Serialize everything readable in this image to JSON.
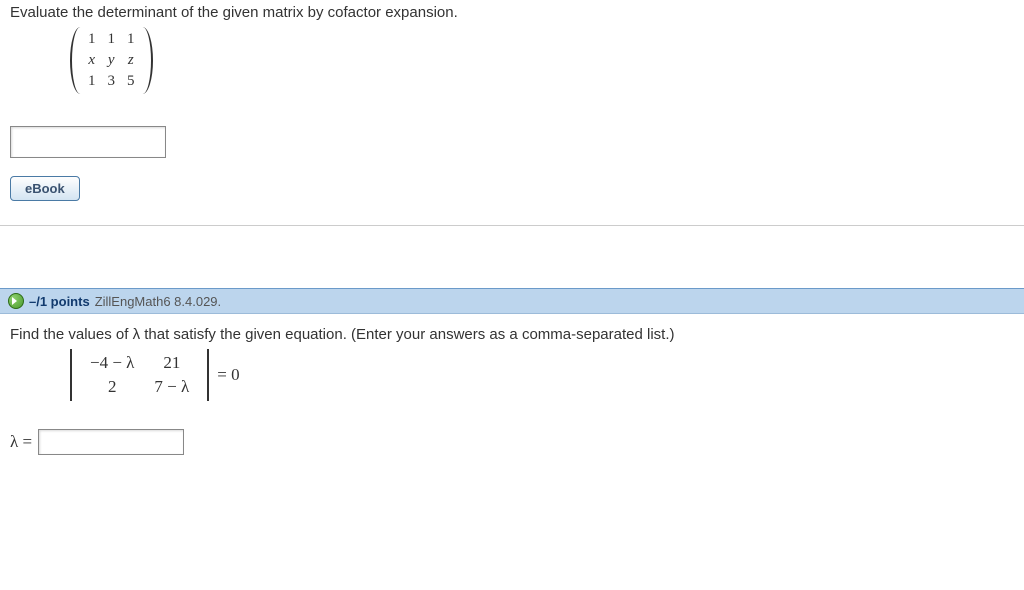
{
  "q1": {
    "prompt": "Evaluate the determinant of the given matrix by cofactor expansion.",
    "matrix": [
      [
        "1",
        "1",
        "1"
      ],
      [
        "x",
        "y",
        "z"
      ],
      [
        "1",
        "3",
        "5"
      ]
    ],
    "ebook_label": "eBook"
  },
  "q2": {
    "points": "–/1 points",
    "source": "ZillEngMath6 8.4.029.",
    "prompt": "Find the values of λ that satisfy the given equation. (Enter your answers as a comma-separated list.)",
    "det": [
      [
        "−4 − λ",
        "21"
      ],
      [
        "2",
        "7 − λ"
      ]
    ],
    "equals": "= 0",
    "lambda_label": "λ ="
  },
  "chart_data": {
    "type": "table",
    "title": "Homework question page",
    "items": [
      {
        "type": "determinant_problem",
        "prompt": "Evaluate the determinant of the given matrix by cofactor expansion.",
        "matrix": [
          [
            1,
            1,
            1
          ],
          [
            "x",
            "y",
            "z"
          ],
          [
            1,
            3,
            5
          ]
        ]
      },
      {
        "type": "characteristic_equation",
        "points": "-/1",
        "source": "ZillEngMath6 8.4.029.",
        "prompt": "Find the values of λ that satisfy the given equation.",
        "matrix": [
          [
            "-4-λ",
            21
          ],
          [
            2,
            "7-λ"
          ]
        ],
        "equation": "det = 0"
      }
    ]
  }
}
